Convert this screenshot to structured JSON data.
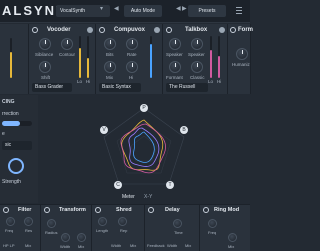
{
  "header": {
    "app_title": "ALSYNTH",
    "preset_name": "VocalSynth",
    "auto_mode_label": "Auto Mode",
    "presets_label": "Presets"
  },
  "modules": {
    "vocoder": {
      "title": "Vocoder",
      "labels": [
        "Sibilance",
        "Contour",
        "Shift",
        "Lo",
        "Hi"
      ],
      "dropdown": "Bass Grader"
    },
    "compuvox": {
      "title": "Compuvox",
      "labels": [
        "Bits",
        "Rate",
        "Mix",
        "Hi"
      ],
      "dropdown": "Basic Syntax"
    },
    "talkbox": {
      "title": "Talkbox",
      "labels": [
        "Speaker",
        "Speaker",
        "Formant",
        "Classic",
        "Lo",
        "Hi"
      ],
      "dropdown": "The Russell"
    },
    "formant": {
      "title": "Form",
      "labels": [
        "Humaniz"
      ]
    }
  },
  "left_panel": {
    "section": "CING",
    "line1": "rrection",
    "line2": "e",
    "line3": "sic",
    "strength_label": "Strength"
  },
  "center": {
    "vertex_labels": [
      "V",
      "B",
      "P",
      "T",
      "C"
    ],
    "meter_label": "Meter",
    "xy_label": "X-Y"
  },
  "bottom_modules": [
    {
      "title": "Filter",
      "labels": [
        "Freq",
        "Res",
        "HP LP",
        "Mix"
      ]
    },
    {
      "title": "Transform",
      "labels": [
        "Radius",
        "Width",
        "Mix"
      ]
    },
    {
      "title": "Shred",
      "labels": [
        "Length",
        "Rep",
        "Width",
        "Mix"
      ]
    },
    {
      "title": "Delay",
      "labels": [
        "Time",
        "Feedback",
        "Width",
        "Mix"
      ]
    },
    {
      "title": "Ring Mod",
      "labels": [
        "Freq",
        "Mix",
        "Drive"
      ]
    }
  ],
  "colors": {
    "accent_vocoder": "#e6b83a",
    "accent_compuvox": "#4aa3ff",
    "accent_talkbox": "#d25aa0",
    "accent_left": "#7fb6ff"
  }
}
